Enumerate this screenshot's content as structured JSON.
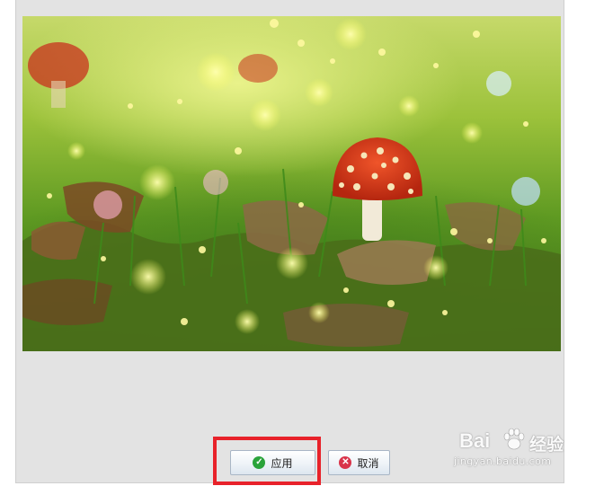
{
  "dialog": {
    "apply_label": "应用",
    "cancel_label": "取消",
    "apply_icon": "check-circle-icon",
    "cancel_icon": "close-circle-icon"
  },
  "watermark": {
    "logo": "Bai",
    "brand_suffix": "经验",
    "url": "jingyan.baidu.com"
  },
  "colors": {
    "highlight": "#e8222a",
    "apply_icon": "#2aa33a",
    "cancel_icon": "#d9344a"
  }
}
